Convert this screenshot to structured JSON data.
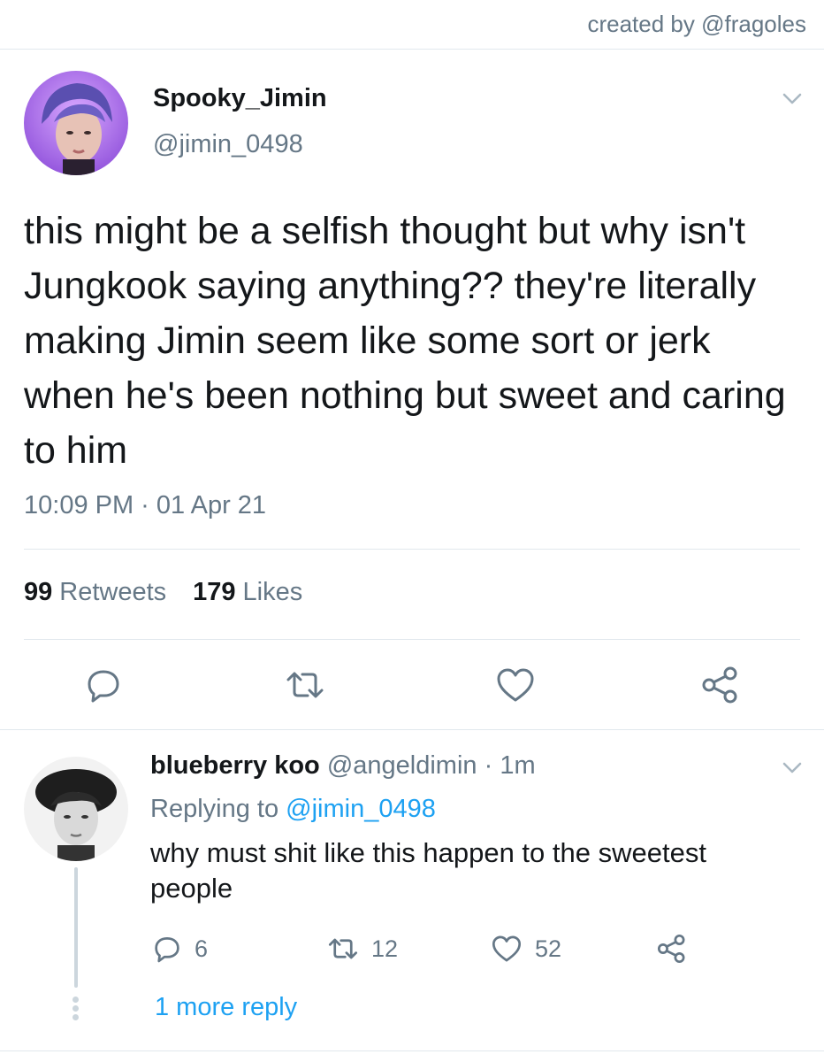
{
  "credit": "created by @fragoles",
  "tweet": {
    "display_name": "Spooky_Jimin",
    "handle": "@jimin_0498",
    "text": "this might be a selfish thought but why isn't Jungkook saying anything?? they're literally making Jimin seem like some sort or jerk when he's been nothing but sweet and caring to him",
    "time": "10:09 PM · 01 Apr 21",
    "retweets_count": "99",
    "retweets_label": "Retweets",
    "likes_count": "179",
    "likes_label": "Likes",
    "actions": [
      "reply-icon",
      "retweet-icon",
      "like-icon",
      "share-icon"
    ]
  },
  "reply": {
    "display_name": "blueberry koo",
    "handle": "@angeldimin",
    "separator": "·",
    "age": "1m",
    "replying_prefix": "Replying to",
    "replying_to": "@jimin_0498",
    "text": "why must shit like this happen to the sweetest people",
    "reply_count": "6",
    "retweet_count": "12",
    "like_count": "52",
    "more_replies": "1 more reply"
  },
  "colors": {
    "text_primary": "#14171a",
    "text_secondary": "#657786",
    "link": "#1da1f2",
    "divider": "#e1e8ed",
    "thread_line": "#ccd6dd"
  }
}
